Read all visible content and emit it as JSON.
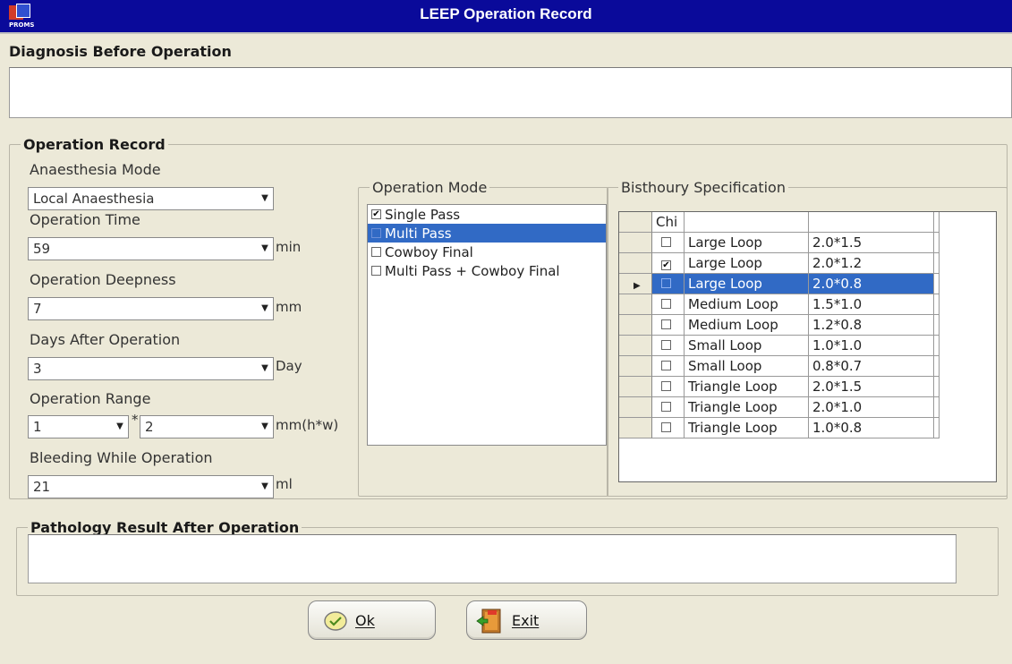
{
  "window": {
    "title": "LEEP Operation Record",
    "icon_text": "PROMS"
  },
  "diagnosis": {
    "label": "Diagnosis Before Operation",
    "value": ""
  },
  "operation_record": {
    "legend": "Operation Record",
    "anaesthesia_mode": {
      "label": "Anaesthesia Mode",
      "value": "Local Anaesthesia"
    },
    "operation_time": {
      "label": "Operation Time",
      "value": "59",
      "unit": "min"
    },
    "operation_deepness": {
      "label": "Operation Deepness",
      "value": "7",
      "unit": "mm"
    },
    "days_after_operation": {
      "label": "Days After Operation",
      "value": "3",
      "unit": "Day"
    },
    "operation_range": {
      "label": "Operation Range",
      "h_value": "1",
      "separator": "*",
      "w_value": "2",
      "unit": "mm(h*w)"
    },
    "bleeding": {
      "label": "Bleeding While Operation",
      "value": "21",
      "unit": "ml"
    }
  },
  "operation_mode": {
    "legend": "Operation Mode",
    "items": [
      {
        "label": "Single Pass",
        "checked": true,
        "selected": false
      },
      {
        "label": "Multi Pass",
        "checked": false,
        "selected": true
      },
      {
        "label": "Cowboy Final",
        "checked": false,
        "selected": false
      },
      {
        "label": "Multi Pass + Cowboy Final",
        "checked": false,
        "selected": false
      }
    ]
  },
  "bisthoury": {
    "legend": "Bisthoury Specification",
    "headers": [
      "Chi",
      "",
      ""
    ],
    "rows": [
      {
        "checked": false,
        "name": "Large Loop",
        "size": "2.0*1.5",
        "current": false
      },
      {
        "checked": true,
        "name": "Large Loop",
        "size": "2.0*1.2",
        "current": false
      },
      {
        "checked": false,
        "name": "Large Loop",
        "size": "2.0*0.8",
        "current": true
      },
      {
        "checked": false,
        "name": "Medium Loop",
        "size": "1.5*1.0",
        "current": false
      },
      {
        "checked": false,
        "name": "Medium Loop",
        "size": "1.2*0.8",
        "current": false
      },
      {
        "checked": false,
        "name": "Small Loop",
        "size": "1.0*1.0",
        "current": false
      },
      {
        "checked": false,
        "name": "Small Loop",
        "size": "0.8*0.7",
        "current": false
      },
      {
        "checked": false,
        "name": "Triangle Loop",
        "size": "2.0*1.5",
        "current": false
      },
      {
        "checked": false,
        "name": "Triangle Loop",
        "size": "2.0*1.0",
        "current": false
      },
      {
        "checked": false,
        "name": "Triangle Loop",
        "size": "1.0*0.8",
        "current": false
      }
    ]
  },
  "pathology": {
    "legend": "Pathology Result After Operation",
    "value": ""
  },
  "buttons": {
    "ok_label": "Ok",
    "exit_label": "Exit"
  },
  "colors": {
    "titlebar": "#0a0a9a",
    "window_bg": "#ece9d8",
    "selection": "#316ac5"
  }
}
